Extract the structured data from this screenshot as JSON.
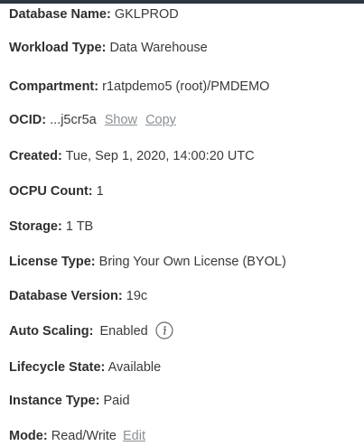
{
  "database_name": {
    "label": "Database Name:",
    "value": "GKLPROD"
  },
  "workload_type": {
    "label": "Workload Type:",
    "value": "Data Warehouse"
  },
  "compartment": {
    "label": "Compartment:",
    "value": "r1atpdemo5 (root)/PMDEMO"
  },
  "ocid": {
    "label": "OCID:",
    "value": "...j5cr5a",
    "show_label": "Show",
    "copy_label": "Copy"
  },
  "created": {
    "label": "Created:",
    "value": "Tue, Sep 1, 2020, 14:00:20 UTC"
  },
  "ocpu_count": {
    "label": "OCPU Count:",
    "value": "1"
  },
  "storage": {
    "label": "Storage:",
    "value": "1 TB"
  },
  "license_type": {
    "label": "License Type:",
    "value": "Bring Your Own License (BYOL)"
  },
  "database_version": {
    "label": "Database Version:",
    "value": "19c"
  },
  "auto_scaling": {
    "label": "Auto Scaling:",
    "value": "Enabled",
    "icon": "info-circle-icon"
  },
  "lifecycle_state": {
    "label": "Lifecycle State:",
    "value": "Available"
  },
  "instance_type": {
    "label": "Instance Type:",
    "value": "Paid"
  },
  "mode": {
    "label": "Mode:",
    "value": "Read/Write",
    "edit_label": "Edit"
  }
}
